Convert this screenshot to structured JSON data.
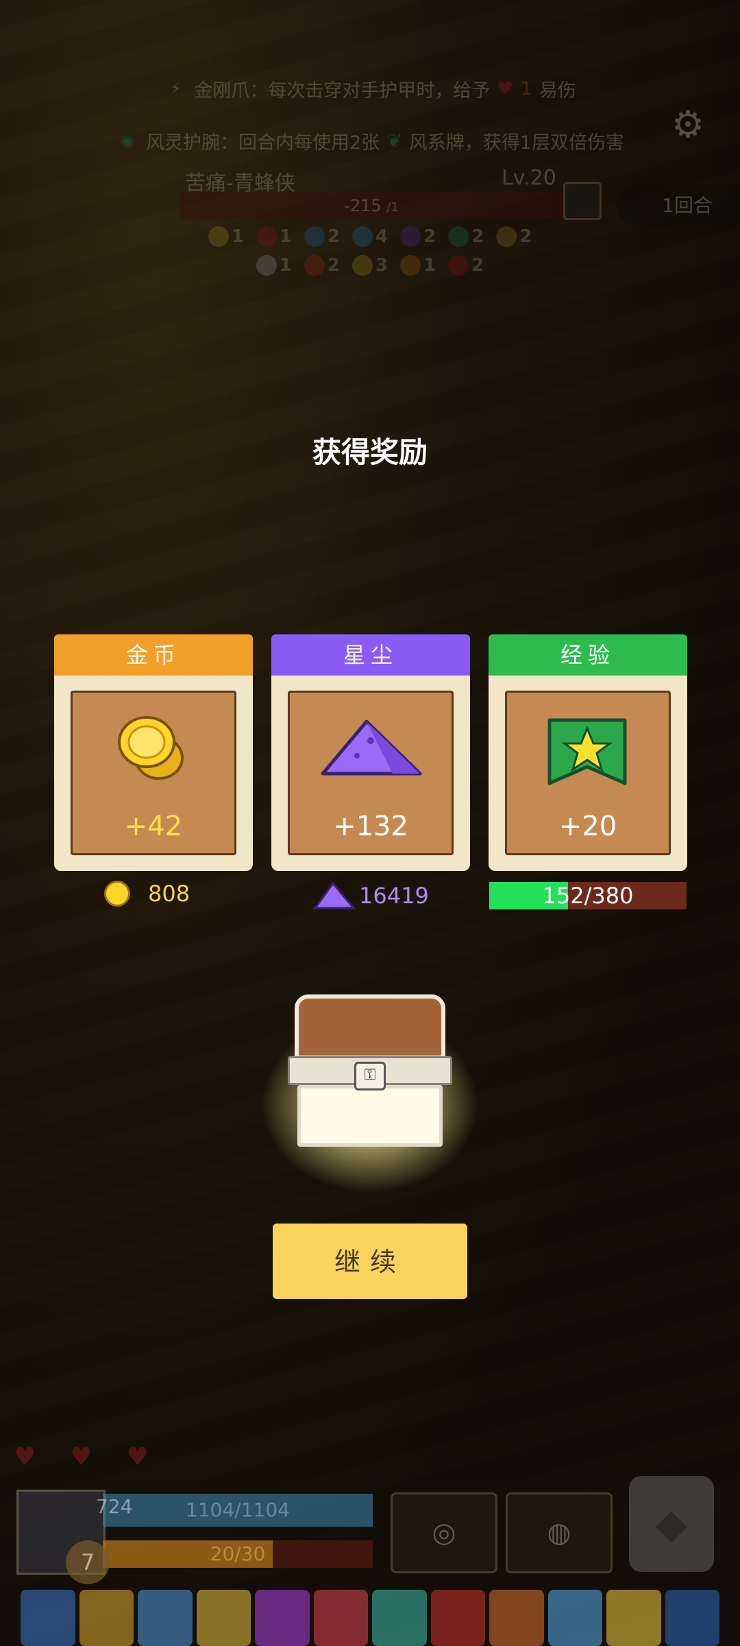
{
  "hud": {
    "relic1": {
      "name_text": "金刚爪：每次击穿对手护甲时，给予",
      "count": "1",
      "suffix": "易伤"
    },
    "relic2": {
      "prefix": "风灵护腕：回合内每使用2张",
      "suffix": "风系牌，获得1层双倍伤害"
    },
    "enemy_name": "苦痛-青蜂侠",
    "enemy_level": "Lv.20",
    "enemy_hp": "-215",
    "enemy_hp_sub": "/1",
    "round": "1回合",
    "status_row1": [
      "1",
      "1",
      "2",
      "4",
      "2",
      "2",
      "2"
    ],
    "status_row2": [
      "1",
      "2",
      "3",
      "1",
      "2"
    ]
  },
  "reward": {
    "title": "获得奖励",
    "cards": [
      {
        "label": "金币",
        "amount": "+42",
        "total": "808",
        "color": "#f2a028",
        "amount_color": "#ffe24a"
      },
      {
        "label": "星尘",
        "amount": "+132",
        "total": "16419",
        "color": "#8a5cf5",
        "amount_color": "#ffffff"
      },
      {
        "label": "经验",
        "amount": "+20",
        "total": "152/380",
        "color": "#2dbb4e",
        "amount_color": "#ffffff",
        "progress": 0.4
      }
    ],
    "continue_label": "继续"
  },
  "player": {
    "armor": "724",
    "hp": "1104/1104",
    "energy": "20/30",
    "level": "7"
  }
}
